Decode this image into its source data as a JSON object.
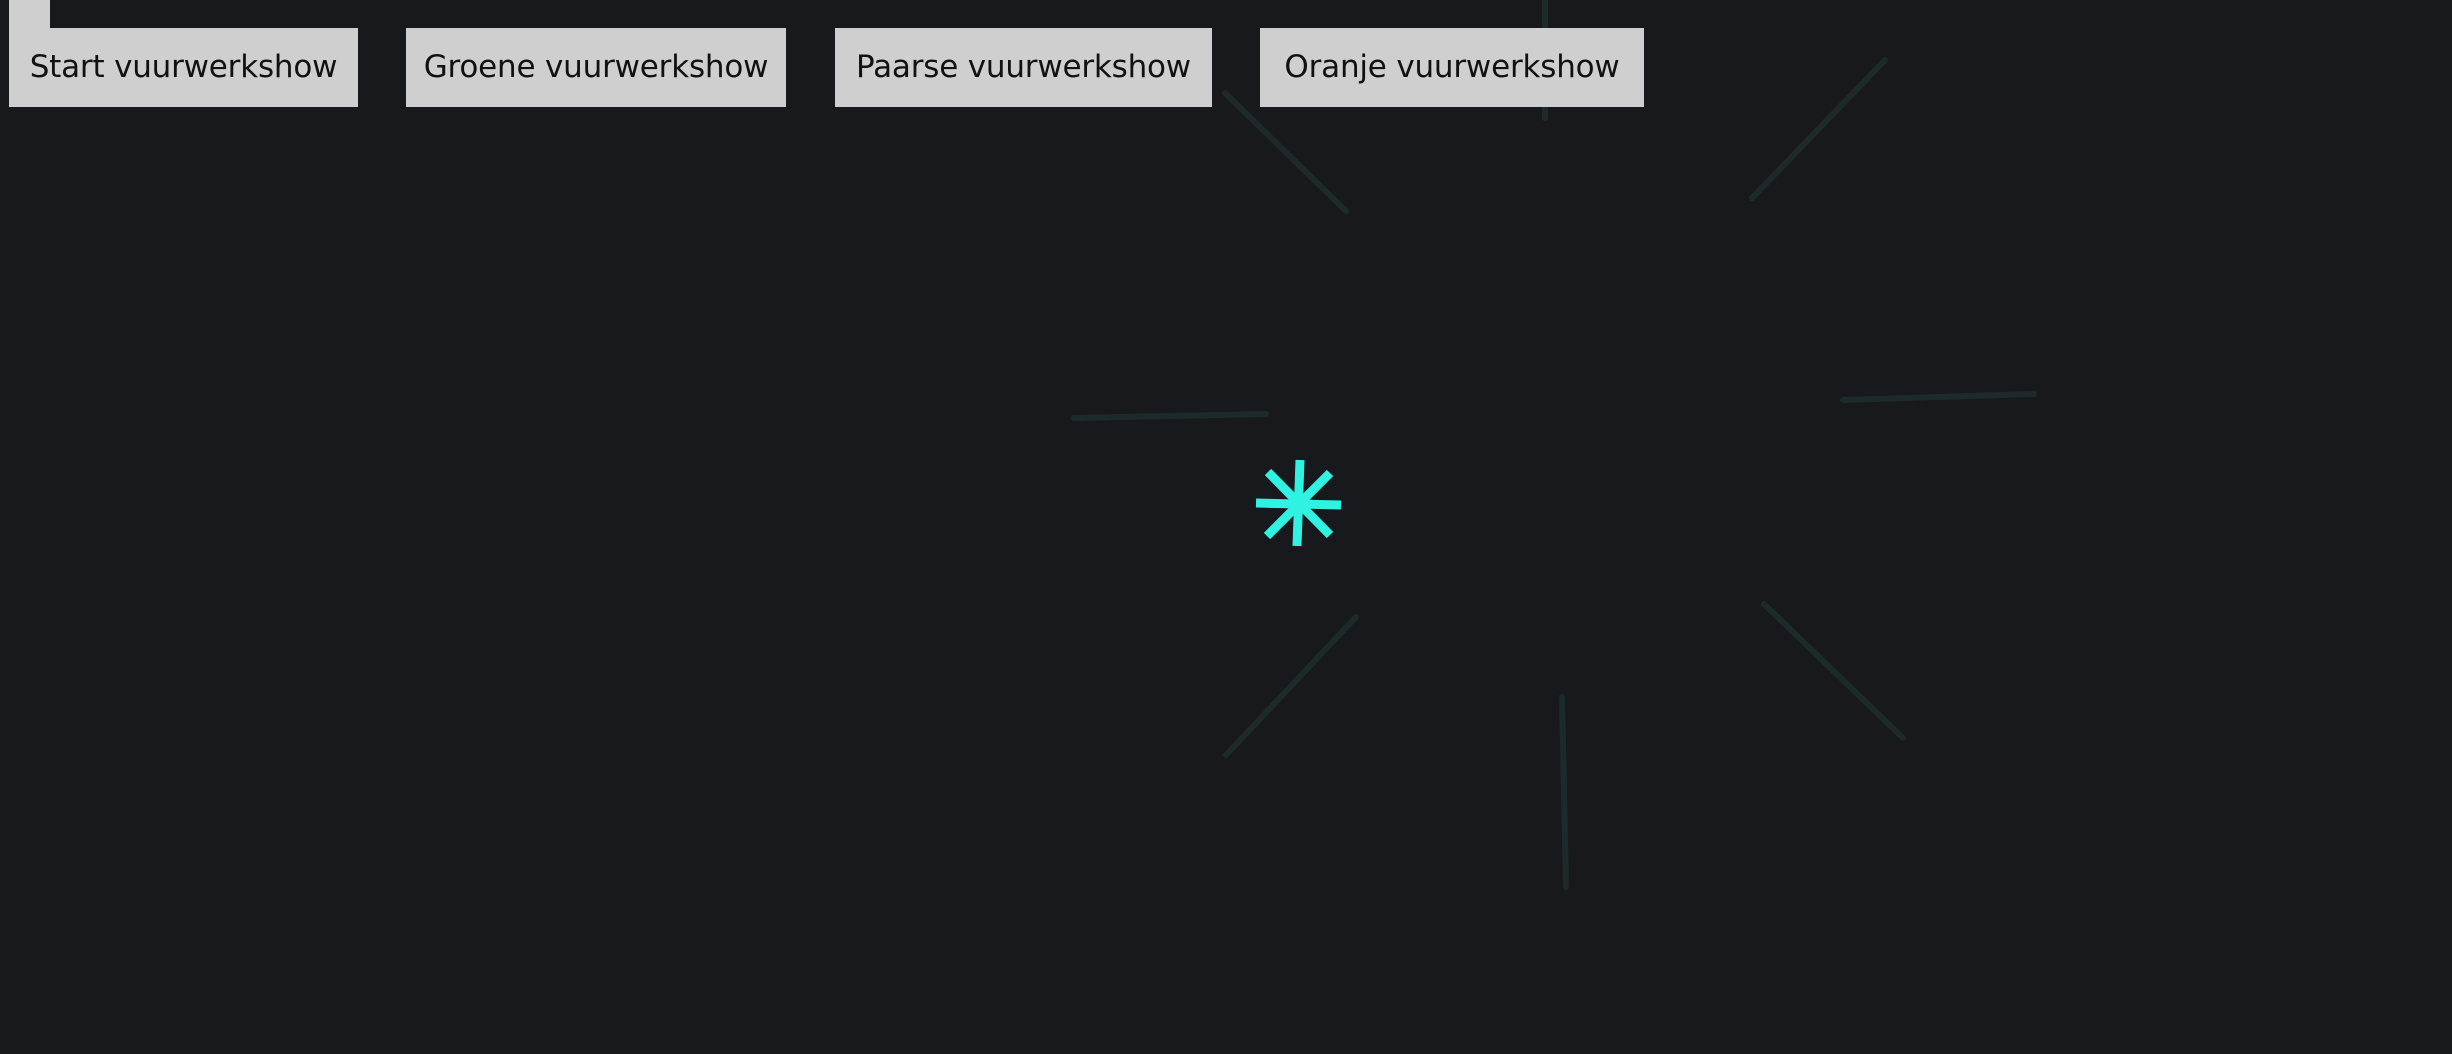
{
  "buttons": {
    "start_label": "Start vuurwerkshow",
    "green_label": "Groene vuurwerkshow",
    "purple_label": "Paarse vuurwerkshow",
    "orange_label": "Oranje vuurwerkshow"
  },
  "colors": {
    "background": "#17191c",
    "button_background": "#cfcfcf",
    "button_text": "#111111",
    "spark": "#2ff2e2",
    "trail": "#1d2a2c"
  },
  "icons": {
    "spark": "asterisk-firework-spark"
  }
}
